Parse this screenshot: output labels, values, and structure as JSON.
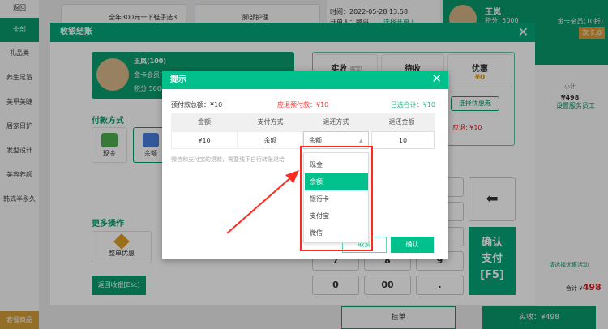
{
  "sidebar": {
    "back": "返回",
    "items": [
      "全部",
      "礼品类",
      "养生足浴",
      "美甲美睫",
      "居家日护",
      "发型设计",
      "美容养颜",
      "韩式半永久"
    ],
    "bottom": "套餐商品"
  },
  "products": [
    "全年300元一下鞋子选3",
    "脚部护理"
  ],
  "order": {
    "time": "时间：2022-05-28 13:58",
    "opener": "开单人：鹏哥",
    "choose_opener": "选择开单人"
  },
  "member_header": {
    "name": "王岚",
    "points": "积分: 5000",
    "level": "金卡会员(10折)",
    "times_card": "次卡:0"
  },
  "right_panel": {
    "subtotal_label": "小计",
    "subtotal": "¥498",
    "set_staff": "设置服务员工",
    "choose_promo": "请选择优惠活动",
    "total_label": "合计 ¥",
    "total": "498",
    "hang": "挂单",
    "pay": "实收：¥498"
  },
  "checkout": {
    "title": "收银结账",
    "member": {
      "name": "王岚(100)",
      "level": "金卡会员(10折)",
      "points": "积分:5000"
    },
    "pay_method_title": "付款方式",
    "pay_methods": [
      "现金",
      "余额"
    ],
    "more_title": "更多操作",
    "more": [
      "整单优惠"
    ],
    "back_button": "返回收银[Esc]",
    "summary": {
      "received": "实收",
      "wipe": "抹零",
      "pending": "待收",
      "discount": "优惠",
      "discount_value": "¥0",
      "coupon": "选择优惠券",
      "refund": "应退: ¥10"
    },
    "keys": [
      "7",
      "8",
      "9",
      "0",
      "00",
      "."
    ],
    "confirm": [
      "确认",
      "支付",
      "[F5]"
    ]
  },
  "prompt": {
    "title": "提示",
    "total": "预付款总额：¥10",
    "should_refund": "应退预付款：¥10",
    "selected": "已选合计：¥10",
    "headers": [
      "金额",
      "支付方式",
      "退还方式",
      "退还金额"
    ],
    "row": {
      "amount": "¥10",
      "method": "余额",
      "refund_method": "余额",
      "refund_amount": "10"
    },
    "note": "微信和支付宝的退款，需要线下自行转账退给",
    "options": [
      "现金",
      "余额",
      "银行卡",
      "支付宝",
      "微信"
    ],
    "selected_option": "余额",
    "cancel": "取消",
    "ok": "确认"
  },
  "colors": {
    "brand": "#00c08b",
    "dark_green": "#03a678",
    "red": "#ff3333",
    "highlight": "#ff2a1f"
  }
}
